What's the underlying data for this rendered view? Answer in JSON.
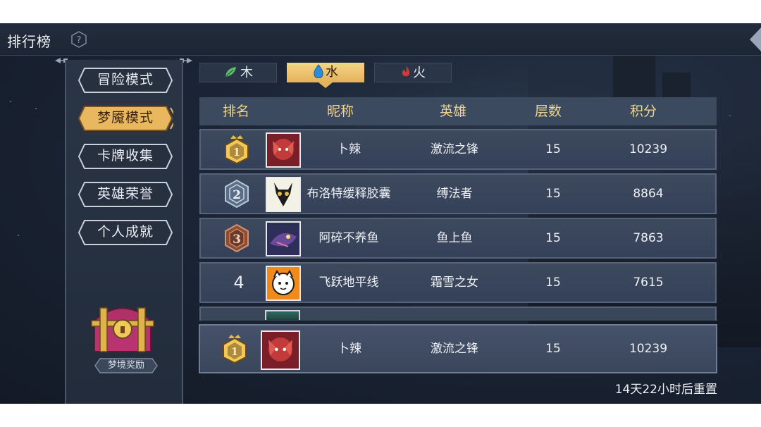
{
  "header": {
    "title": "排行榜"
  },
  "menu": [
    {
      "label": "冒险模式",
      "active": false
    },
    {
      "label": "梦魇模式",
      "active": true
    },
    {
      "label": "卡牌收集",
      "active": false
    },
    {
      "label": "英雄荣誉",
      "active": false
    },
    {
      "label": "个人成就",
      "active": false
    }
  ],
  "reward": {
    "label": "梦境奖励"
  },
  "tabs": [
    {
      "label": "木",
      "icon": "leaf-icon",
      "color": "#5fbf6a"
    },
    {
      "label": "水",
      "icon": "water-drop-icon",
      "color": "#2a8fd6",
      "selected": true
    },
    {
      "label": "火",
      "icon": "flame-icon",
      "color": "#d23a3a"
    }
  ],
  "table": {
    "headers": [
      "排名",
      "昵称",
      "英雄",
      "层数",
      "积分"
    ],
    "rows": [
      {
        "rank": "1",
        "nickname": "卜辣",
        "hero": "激流之锋",
        "floors": "15",
        "score": "10239"
      },
      {
        "rank": "2",
        "nickname": "布洛特缓释胶囊",
        "hero": "缚法者",
        "floors": "15",
        "score": "8864"
      },
      {
        "rank": "3",
        "nickname": "阿碎不养鱼",
        "hero": "鱼上鱼",
        "floors": "15",
        "score": "7863"
      },
      {
        "rank": "4",
        "nickname": "飞跃地平线",
        "hero": "霜雪之女",
        "floors": "15",
        "score": "7615"
      }
    ]
  },
  "self": {
    "rank": "1",
    "nickname": "卜辣",
    "hero": "激流之锋",
    "floors": "15",
    "score": "10239"
  },
  "footer": {
    "reset": "14天22小时后重置"
  },
  "colors": {
    "gold": "#f1d48c",
    "panel": "#2a3546",
    "bg": "#1b2536"
  }
}
